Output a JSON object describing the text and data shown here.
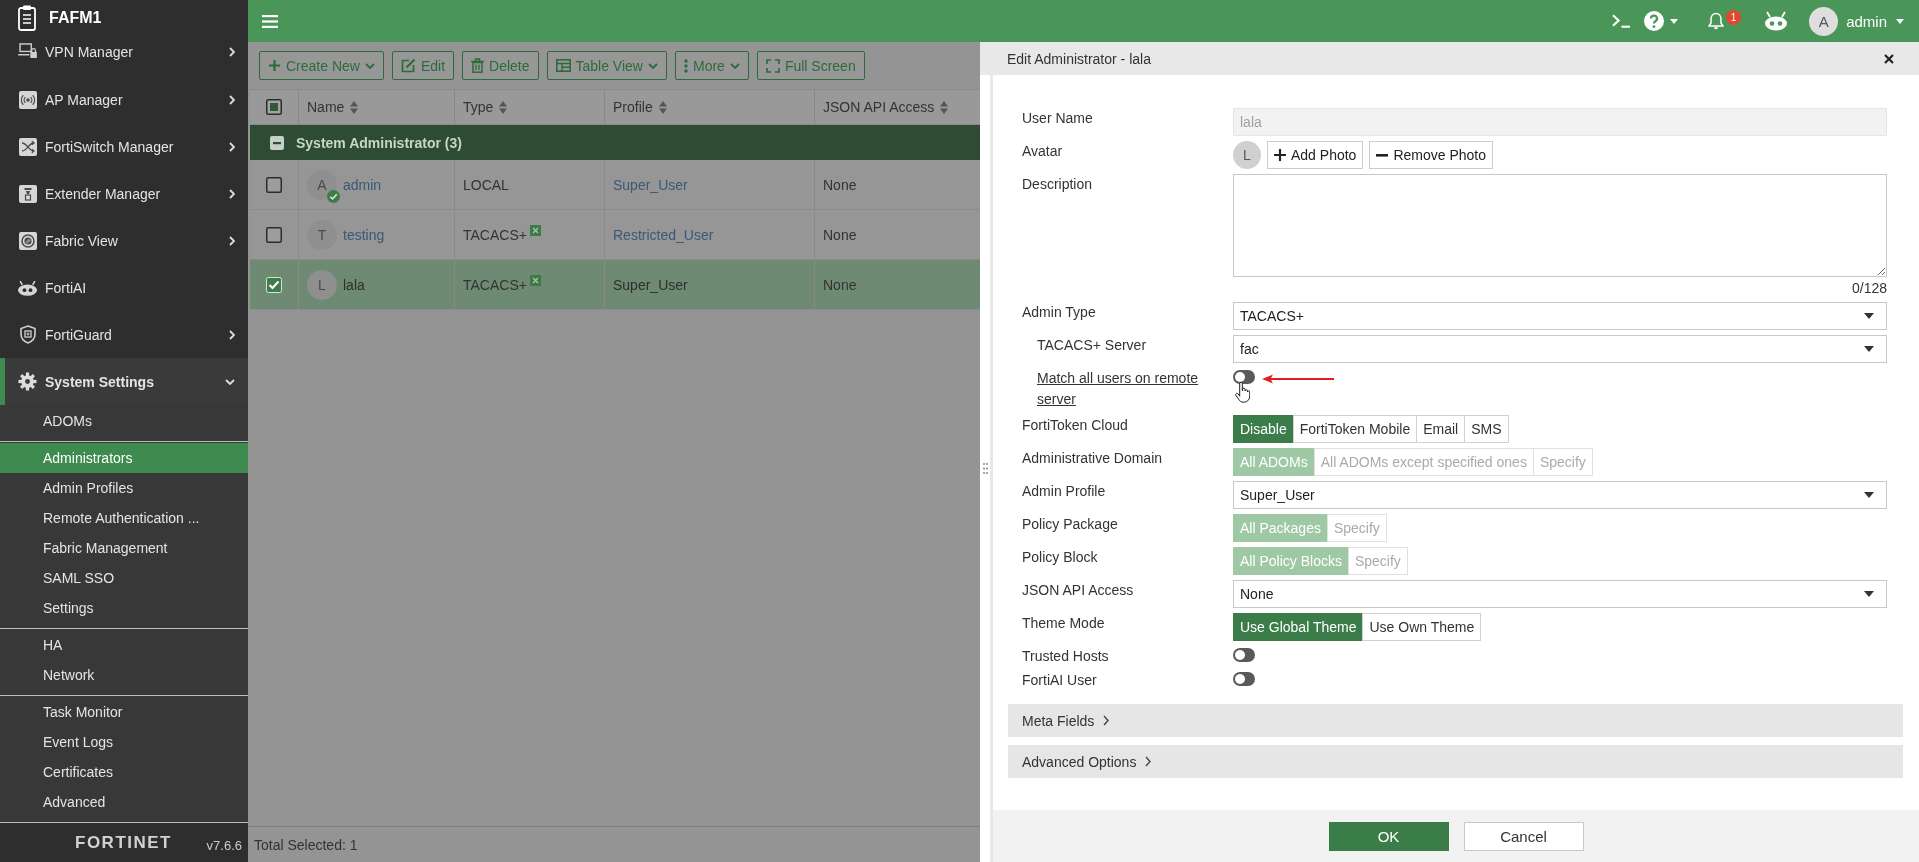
{
  "sidebar": {
    "title": "FAFM1",
    "items": [
      {
        "label": "VPN Manager",
        "has_submenu": true,
        "expanded": false,
        "selected": false
      },
      {
        "label": "AP Manager",
        "has_submenu": true,
        "expanded": false,
        "selected": false
      },
      {
        "label": "FortiSwitch Manager",
        "has_submenu": true,
        "expanded": false,
        "selected": false
      },
      {
        "label": "Extender Manager",
        "has_submenu": true,
        "expanded": false,
        "selected": false
      },
      {
        "label": "Fabric View",
        "has_submenu": true,
        "expanded": false,
        "selected": false
      },
      {
        "label": "FortiAI",
        "has_submenu": false,
        "expanded": false,
        "selected": false
      },
      {
        "label": "FortiGuard",
        "has_submenu": true,
        "expanded": false,
        "selected": false
      },
      {
        "label": "System Settings",
        "has_submenu": true,
        "expanded": true,
        "selected": true,
        "children": [
          {
            "items": [
              {
                "label": "ADOMs",
                "selected": false
              }
            ]
          },
          {
            "items": [
              {
                "label": "Administrators",
                "selected": true
              },
              {
                "label": "Admin Profiles",
                "selected": false
              },
              {
                "label": "Remote Authentication ...",
                "selected": false
              },
              {
                "label": "Fabric Management",
                "selected": false
              },
              {
                "label": "SAML SSO",
                "selected": false
              },
              {
                "label": "Settings",
                "selected": false
              }
            ]
          },
          {
            "items": [
              {
                "label": "HA",
                "selected": false
              },
              {
                "label": "Network",
                "selected": false
              }
            ]
          },
          {
            "items": [
              {
                "label": "Task Monitor",
                "selected": false
              },
              {
                "label": "Event Logs",
                "selected": false
              },
              {
                "label": "Certificates",
                "selected": false
              },
              {
                "label": "Advanced",
                "selected": false
              }
            ]
          }
        ]
      }
    ],
    "logo": "FORTINET",
    "version": "v7.6.6"
  },
  "header": {
    "notifications": "1",
    "user": {
      "initial": "A",
      "name": "admin"
    }
  },
  "toolbar": {
    "buttons": [
      {
        "label": "Create New",
        "dropdown": true
      },
      {
        "label": "Edit",
        "dropdown": false
      },
      {
        "label": "Delete",
        "dropdown": false
      },
      {
        "label": "Table View",
        "dropdown": true
      },
      {
        "label": "More",
        "dropdown": true
      },
      {
        "label": "Full Screen",
        "dropdown": false
      }
    ]
  },
  "table": {
    "select_all": {
      "checked": false,
      "indeterminate": true
    },
    "columns": [
      {
        "label": "Name",
        "sortable": true
      },
      {
        "label": "Type",
        "sortable": true
      },
      {
        "label": "Profile",
        "sortable": true
      },
      {
        "label": "JSON API Access",
        "sortable": true
      }
    ],
    "groups": [
      {
        "label": "System Administrator (3)",
        "expanded": true,
        "rows": [
          {
            "checked": false,
            "selected": false,
            "avatar": "A",
            "verified": true,
            "name": "admin",
            "type": "LOCAL",
            "remote": false,
            "profile": "Super_User",
            "json_api_access": "None"
          },
          {
            "checked": false,
            "selected": false,
            "avatar": "T",
            "verified": false,
            "name": "testing",
            "type": "TACACS+",
            "remote": true,
            "profile": "Restricted_User",
            "json_api_access": "None"
          },
          {
            "checked": true,
            "selected": true,
            "avatar": "L",
            "verified": false,
            "name": "lala",
            "type": "TACACS+",
            "remote": true,
            "profile": "Super_User",
            "json_api_access": "None"
          }
        ]
      }
    ]
  },
  "status_bar": {
    "text": "Total Selected: 1"
  },
  "dialog": {
    "title": "Edit Administrator - lala",
    "fields": [
      {
        "kind": "text",
        "label": "User Name",
        "value": "lala",
        "disabled": true
      },
      {
        "kind": "avatar",
        "label": "Avatar",
        "initial": "L",
        "buttons": [
          {
            "kind": "add",
            "label": "Add Photo"
          },
          {
            "kind": "remove",
            "label": "Remove Photo"
          }
        ]
      },
      {
        "kind": "textarea",
        "label": "Description",
        "counter": "0/128"
      },
      {
        "kind": "select",
        "label": "Admin Type",
        "value": "TACACS+",
        "children": [
          {
            "kind": "select",
            "label": "TACACS+ Server",
            "value": "fac"
          },
          {
            "kind": "toggle",
            "label": "Match all users on remote server",
            "on": false,
            "link": true,
            "annotated": true,
            "hovered": true
          }
        ]
      },
      {
        "kind": "segmented",
        "label": "FortiToken Cloud",
        "disabled": false,
        "options": [
          {
            "label": "Disable",
            "selected": true
          },
          {
            "label": "FortiToken Mobile",
            "selected": false
          },
          {
            "label": "Email",
            "selected": false
          },
          {
            "label": "SMS",
            "selected": false
          }
        ]
      },
      {
        "kind": "segmented",
        "label": "Administrative Domain",
        "disabled": true,
        "options": [
          {
            "label": "All ADOMs",
            "selected": true
          },
          {
            "label": "All ADOMs except specified ones",
            "selected": false
          },
          {
            "label": "Specify",
            "selected": false
          }
        ]
      },
      {
        "kind": "select",
        "label": "Admin Profile",
        "value": "Super_User"
      },
      {
        "kind": "segmented",
        "label": "Policy Package",
        "disabled": true,
        "options": [
          {
            "label": "All Packages",
            "selected": true
          },
          {
            "label": "Specify",
            "selected": false
          }
        ]
      },
      {
        "kind": "segmented",
        "label": "Policy Block",
        "disabled": true,
        "options": [
          {
            "label": "All Policy Blocks",
            "selected": true
          },
          {
            "label": "Specify",
            "selected": false
          }
        ]
      },
      {
        "kind": "select",
        "label": "JSON API Access",
        "value": "None"
      },
      {
        "kind": "segmented",
        "label": "Theme Mode",
        "disabled": false,
        "options": [
          {
            "label": "Use Global Theme",
            "selected": true
          },
          {
            "label": "Use Own Theme",
            "selected": false
          }
        ]
      },
      {
        "kind": "toggle",
        "label": "Trusted Hosts",
        "on": false,
        "link": false,
        "annotated": false,
        "hovered": false
      },
      {
        "kind": "toggle",
        "label": "FortiAI User",
        "on": false,
        "link": false,
        "annotated": false,
        "hovered": false
      }
    ],
    "sections": [
      {
        "label": "Meta Fields",
        "expanded": false
      },
      {
        "label": "Advanced Options",
        "expanded": false
      }
    ],
    "buttons": [
      {
        "label": "OK",
        "primary": true
      },
      {
        "label": "Cancel",
        "primary": false
      }
    ]
  }
}
